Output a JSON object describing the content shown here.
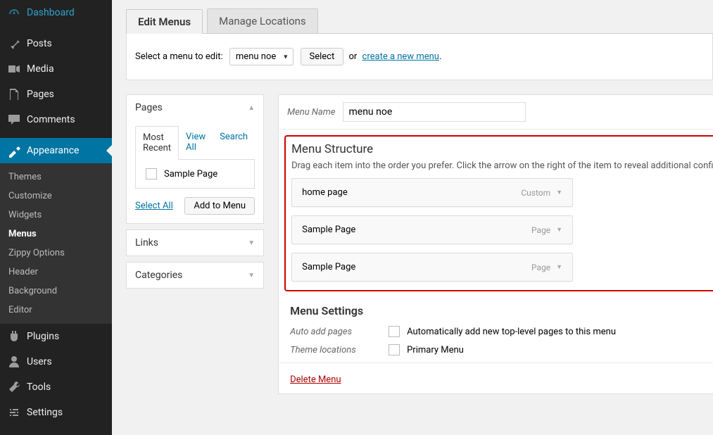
{
  "sidebar": {
    "items": [
      {
        "label": "Dashboard",
        "icon": "dashboard"
      },
      {
        "label": "Posts",
        "icon": "pin"
      },
      {
        "label": "Media",
        "icon": "media"
      },
      {
        "label": "Pages",
        "icon": "page"
      },
      {
        "label": "Comments",
        "icon": "comment"
      },
      {
        "label": "Appearance",
        "icon": "appearance",
        "active": true
      },
      {
        "label": "Plugins",
        "icon": "plugin"
      },
      {
        "label": "Users",
        "icon": "user"
      },
      {
        "label": "Tools",
        "icon": "tool"
      },
      {
        "label": "Settings",
        "icon": "settings"
      }
    ],
    "submenu": [
      "Themes",
      "Customize",
      "Widgets",
      "Menus",
      "Zippy Options",
      "Header",
      "Background",
      "Editor"
    ],
    "submenu_current": "Menus"
  },
  "tabs": {
    "edit": "Edit Menus",
    "manage": "Manage Locations"
  },
  "selector": {
    "label": "Select a menu to edit:",
    "value": "menu noe",
    "select_btn": "Select",
    "or": "or",
    "create_link": "create a new menu"
  },
  "pages_box": {
    "title": "Pages",
    "tabs": {
      "recent": "Most Recent",
      "all": "View All",
      "search": "Search"
    },
    "item": "Sample Page",
    "select_all": "Select All",
    "add_btn": "Add to Menu"
  },
  "links_box": {
    "title": "Links"
  },
  "cats_box": {
    "title": "Categories"
  },
  "menu_edit": {
    "name_label": "Menu Name",
    "name_value": "menu noe",
    "structure_title": "Menu Structure",
    "structure_hint": "Drag each item into the order you prefer. Click the arrow on the right of the item to reveal additional configuration options.",
    "items": [
      {
        "title": "home page",
        "type": "Custom"
      },
      {
        "title": "Sample Page",
        "type": "Page"
      },
      {
        "title": "Sample Page",
        "type": "Page"
      }
    ],
    "settings_title": "Menu Settings",
    "auto_label": "Auto add pages",
    "auto_text": "Automatically add new top-level pages to this menu",
    "loc_label": "Theme locations",
    "loc_text": "Primary Menu",
    "delete": "Delete Menu"
  }
}
